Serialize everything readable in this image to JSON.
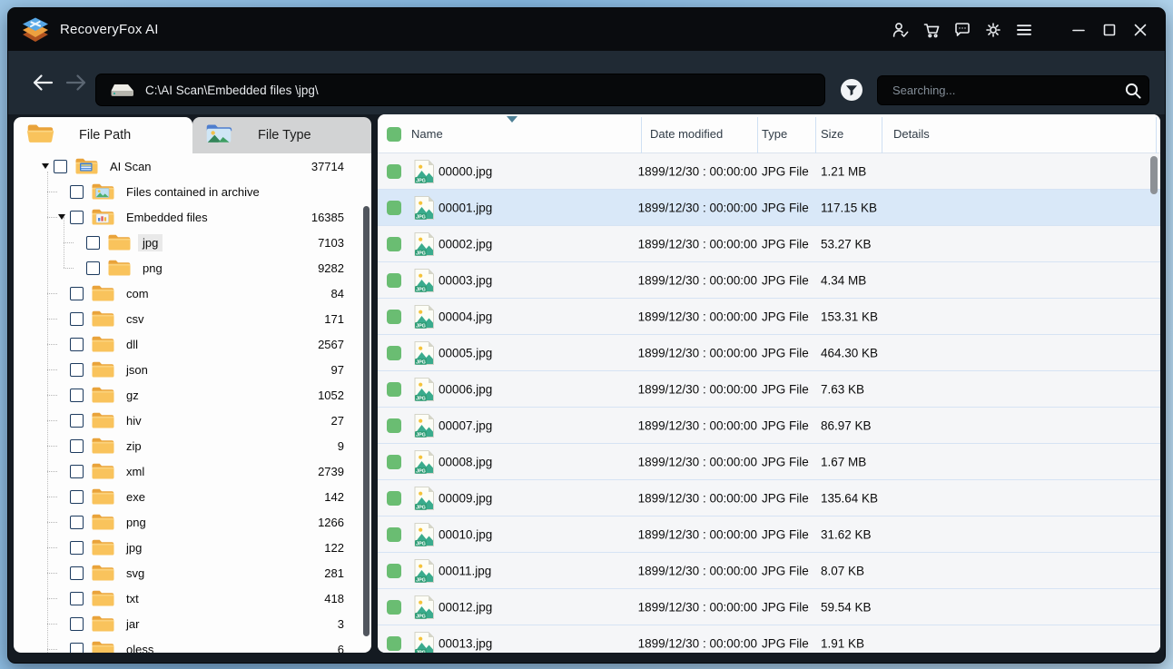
{
  "window": {
    "title": "RecoveryFox AI"
  },
  "titlebar": {
    "icons": [
      "user-check-icon",
      "cart-icon",
      "chat-icon",
      "gear-icon",
      "hamburger-menu-icon"
    ],
    "window_controls": [
      "minimize",
      "maximize",
      "close"
    ]
  },
  "navbar": {
    "path": "C:\\AI Scan\\Embedded files \\jpg\\",
    "search_placeholder": "Searching..."
  },
  "sidebar": {
    "tabs": [
      {
        "label": "File Path",
        "active": true
      },
      {
        "label": "File Type",
        "active": false
      }
    ],
    "tree": [
      {
        "label": "AI Scan",
        "count": "37714",
        "level": 0,
        "icon": "ai",
        "expanded": true
      },
      {
        "label": "Files contained in archive",
        "count": "",
        "level": 1,
        "icon": "pic",
        "expanded": false
      },
      {
        "label": "Embedded files",
        "count": "16385",
        "level": 1,
        "icon": "bars",
        "expanded": true
      },
      {
        "label": "jpg",
        "count": "7103",
        "level": 2,
        "icon": "folder",
        "selected": true
      },
      {
        "label": "png",
        "count": "9282",
        "level": 2,
        "icon": "folder"
      },
      {
        "label": "com",
        "count": "84",
        "level": 1,
        "icon": "folder"
      },
      {
        "label": "csv",
        "count": "171",
        "level": 1,
        "icon": "folder"
      },
      {
        "label": "dll",
        "count": "2567",
        "level": 1,
        "icon": "folder"
      },
      {
        "label": "json",
        "count": "97",
        "level": 1,
        "icon": "folder"
      },
      {
        "label": "gz",
        "count": "1052",
        "level": 1,
        "icon": "folder"
      },
      {
        "label": "hiv",
        "count": "27",
        "level": 1,
        "icon": "folder"
      },
      {
        "label": "zip",
        "count": "9",
        "level": 1,
        "icon": "folder"
      },
      {
        "label": "xml",
        "count": "2739",
        "level": 1,
        "icon": "folder"
      },
      {
        "label": "exe",
        "count": "142",
        "level": 1,
        "icon": "folder"
      },
      {
        "label": "png",
        "count": "1266",
        "level": 1,
        "icon": "folder"
      },
      {
        "label": "jpg",
        "count": "122",
        "level": 1,
        "icon": "folder"
      },
      {
        "label": "svg",
        "count": "281",
        "level": 1,
        "icon": "folder"
      },
      {
        "label": "txt",
        "count": "418",
        "level": 1,
        "icon": "folder"
      },
      {
        "label": "jar",
        "count": "3",
        "level": 1,
        "icon": "folder"
      },
      {
        "label": "oless",
        "count": "6",
        "level": 1,
        "icon": "folder"
      }
    ]
  },
  "table": {
    "columns": [
      "Name",
      "Date modified",
      "Type",
      "Size",
      "Details"
    ],
    "sort_column": "Name",
    "sort_direction": "desc",
    "rows": [
      {
        "name": "00000.jpg",
        "date": "1899/12/30 : 00:00:00",
        "type": "JPG File",
        "size": "1.21 MB"
      },
      {
        "name": "00001.jpg",
        "date": "1899/12/30 : 00:00:00",
        "type": "JPG File",
        "size": "117.15 KB",
        "selected": true
      },
      {
        "name": "00002.jpg",
        "date": "1899/12/30 : 00:00:00",
        "type": "JPG File",
        "size": "53.27 KB"
      },
      {
        "name": "00003.jpg",
        "date": "1899/12/30 : 00:00:00",
        "type": "JPG File",
        "size": "4.34 MB"
      },
      {
        "name": "00004.jpg",
        "date": "1899/12/30 : 00:00:00",
        "type": "JPG File",
        "size": "153.31 KB"
      },
      {
        "name": "00005.jpg",
        "date": "1899/12/30 : 00:00:00",
        "type": "JPG File",
        "size": "464.30 KB"
      },
      {
        "name": "00006.jpg",
        "date": "1899/12/30 : 00:00:00",
        "type": "JPG File",
        "size": "7.63 KB"
      },
      {
        "name": "00007.jpg",
        "date": "1899/12/30 : 00:00:00",
        "type": "JPG File",
        "size": "86.97 KB"
      },
      {
        "name": "00008.jpg",
        "date": "1899/12/30 : 00:00:00",
        "type": "JPG File",
        "size": "1.67 MB"
      },
      {
        "name": "00009.jpg",
        "date": "1899/12/30 : 00:00:00",
        "type": "JPG File",
        "size": "135.64 KB"
      },
      {
        "name": "00010.jpg",
        "date": "1899/12/30 : 00:00:00",
        "type": "JPG File",
        "size": "31.62 KB"
      },
      {
        "name": "00011.jpg",
        "date": "1899/12/30 : 00:00:00",
        "type": "JPG File",
        "size": "8.07 KB"
      },
      {
        "name": "00012.jpg",
        "date": "1899/12/30 : 00:00:00",
        "type": "JPG File",
        "size": "59.54 KB"
      },
      {
        "name": "00013.jpg",
        "date": "1899/12/30 : 00:00:00",
        "type": "JPG File",
        "size": "1.91 KB"
      }
    ]
  },
  "colors": {
    "titlebar_bg": "#0a0c0f",
    "navbar_bg": "#202a34",
    "window_bg": "#141a21",
    "panel_bg": "#fdfdfd",
    "row_bg": "#f5f6f8",
    "row_selected_bg": "#d9e8f8",
    "row_separator": "#d6e3f4",
    "checkbox_green": "#6abd72",
    "folder_yellow": "#f9c35c",
    "sort_arrow": "#4e8096"
  }
}
